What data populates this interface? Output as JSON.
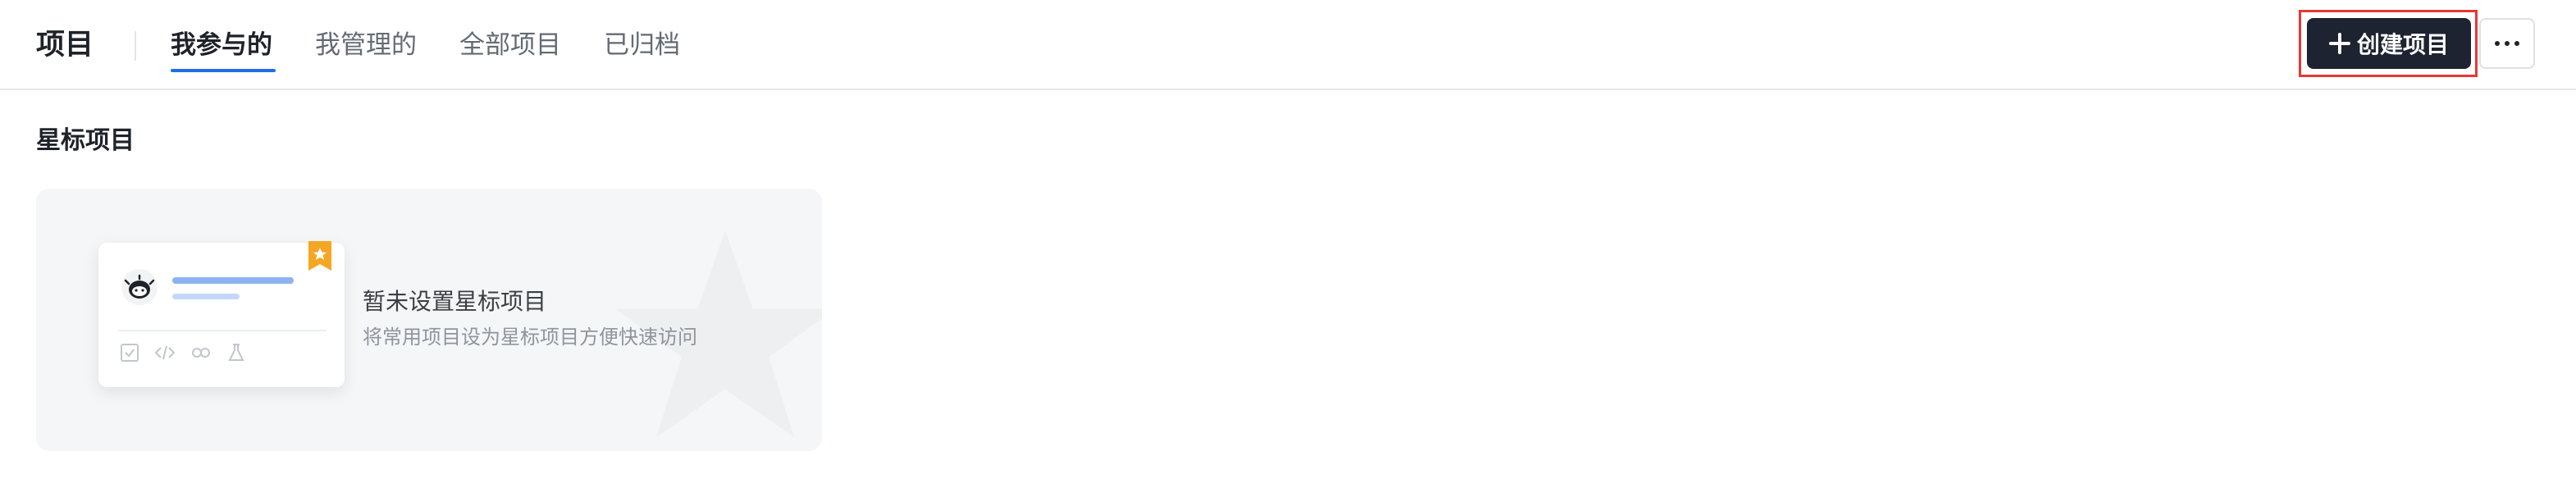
{
  "header": {
    "title": "项目",
    "tabs": [
      {
        "label": "我参与的",
        "active": true
      },
      {
        "label": "我管理的",
        "active": false
      },
      {
        "label": "全部项目",
        "active": false
      },
      {
        "label": "已归档",
        "active": false
      }
    ],
    "create_button_label": "创建项目",
    "more_icon": "more-horizontal-icon"
  },
  "starred": {
    "section_title": "星标项目",
    "empty_title": "暂未设置星标项目",
    "empty_desc": "将常用项目设为星标项目方便快速访问"
  },
  "colors": {
    "accent": "#1f6feb",
    "create_button_bg": "#1d2330",
    "highlight_border": "#e53935",
    "bookmark": "#f5a623"
  }
}
